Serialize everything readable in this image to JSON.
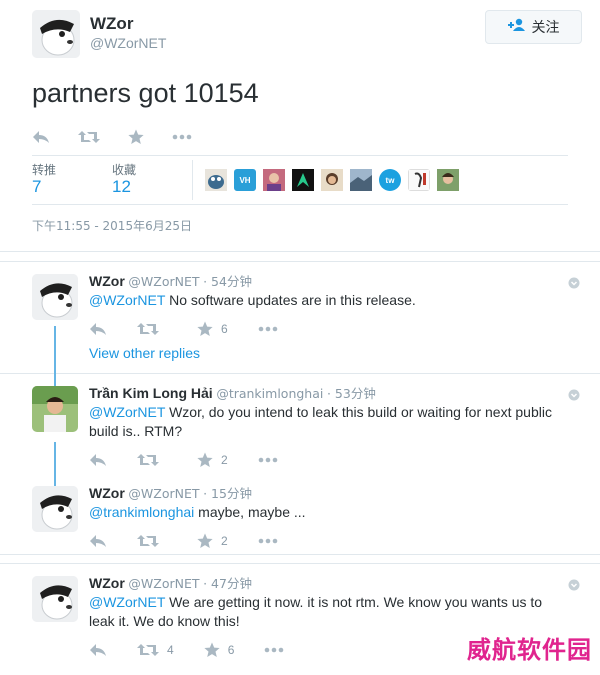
{
  "main_tweet": {
    "fullname": "WZor",
    "screenname": "@WZorNET",
    "follow_label": "关注",
    "text": "partners got 10154",
    "stats": {
      "retweets_label": "转推",
      "retweets_value": "7",
      "likes_label": "收藏",
      "likes_value": "12"
    },
    "fav_avatars": [
      "avatar-1",
      "VH",
      "avatar-3",
      "avatar-4",
      "avatar-5",
      "avatar-6",
      "tw",
      "avatar-8",
      "avatar-9"
    ],
    "timestamp": "下午11:55 - 2015年6月25日"
  },
  "replies": [
    {
      "fullname": "WZor",
      "screenname": "@WZorNET",
      "time": "· 54分钟",
      "mention": "@WZorNET",
      "text": " No software updates are in this release.",
      "retweets": "",
      "likes": "6"
    },
    {
      "fullname": "Trần Kim Long Hải",
      "screenname": "@trankimlonghai",
      "time": "· 53分钟",
      "mention": "@WZorNET",
      "text": " Wzor, do you intend to leak this build or waiting for next public build is.. RTM?",
      "retweets": "",
      "likes": "2"
    },
    {
      "fullname": "WZor",
      "screenname": "@WZorNET",
      "time": "· 15分钟",
      "mention": "@trankimlonghai",
      "text": " maybe, maybe ...",
      "retweets": "",
      "likes": "2"
    },
    {
      "fullname": "WZor",
      "screenname": "@WZorNET",
      "time": "· 47分钟",
      "mention": "@WZorNET",
      "text": "  We are getting it now. it is not rtm. We know you wants us to leak it. We do know this!",
      "retweets": "4",
      "likes": "6"
    }
  ],
  "view_other_replies": "View other replies",
  "watermark": "威航软件园",
  "colors": {
    "link": "#1b95e0",
    "thread_line": "#66b5e5",
    "icon": "#aab8c2",
    "watermark": "#e0248e"
  }
}
